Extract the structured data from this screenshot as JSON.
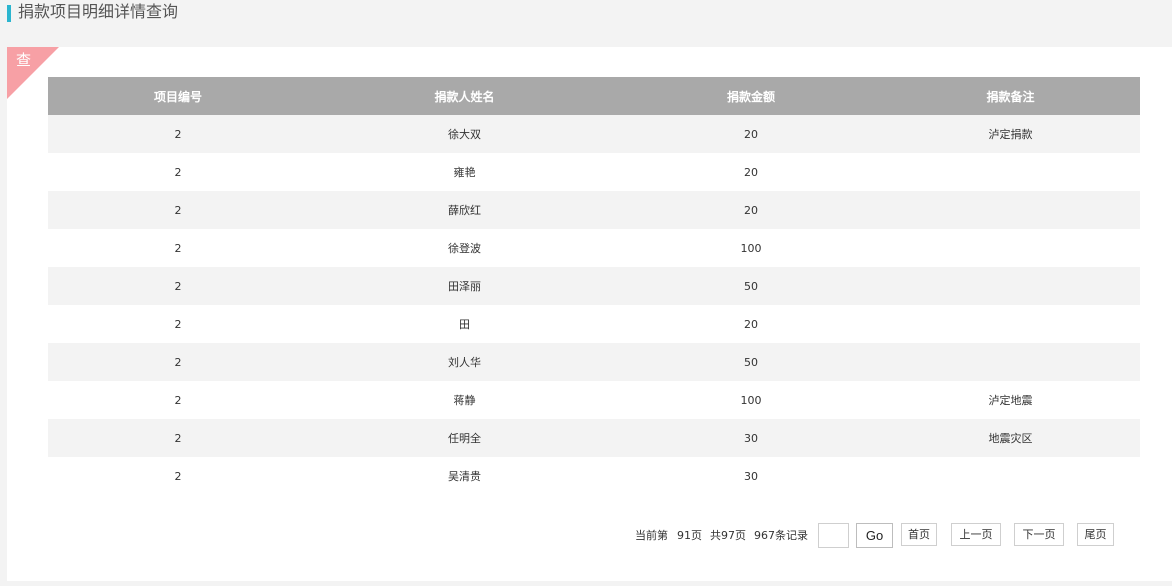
{
  "header": {
    "title": "捐款项目明细详情查询"
  },
  "panel": {
    "corner_label": "查"
  },
  "table": {
    "columns": [
      "项目编号",
      "捐款人姓名",
      "捐款金额",
      "捐款备注"
    ],
    "rows": [
      [
        "2",
        "徐大双",
        "20",
        "泸定捐款"
      ],
      [
        "2",
        "雍艳",
        "20",
        ""
      ],
      [
        "2",
        "薛欣红",
        "20",
        ""
      ],
      [
        "2",
        "徐登波",
        "100",
        ""
      ],
      [
        "2",
        "田泽丽",
        "50",
        ""
      ],
      [
        "2",
        "田",
        "20",
        ""
      ],
      [
        "2",
        "刘人华",
        "50",
        ""
      ],
      [
        "2",
        "蒋静",
        "100",
        "泸定地震"
      ],
      [
        "2",
        "任明全",
        "30",
        "地震灾区"
      ],
      [
        "2",
        "吴清贵",
        "30",
        ""
      ]
    ]
  },
  "pager": {
    "current_label": "当前第",
    "current_page": "91页",
    "total_pages": "共97页",
    "total_records": "967条记录",
    "page_input_value": "",
    "go_label": "Go",
    "first_label": "首页",
    "prev_label": "上一页",
    "next_label": "下一页",
    "last_label": "尾页"
  },
  "colors": {
    "accent_bar": "#2bb5cf",
    "corner": "#f7a0a5",
    "table_header": "#a9a9a9",
    "row_stripe": "#f3f3f3"
  }
}
